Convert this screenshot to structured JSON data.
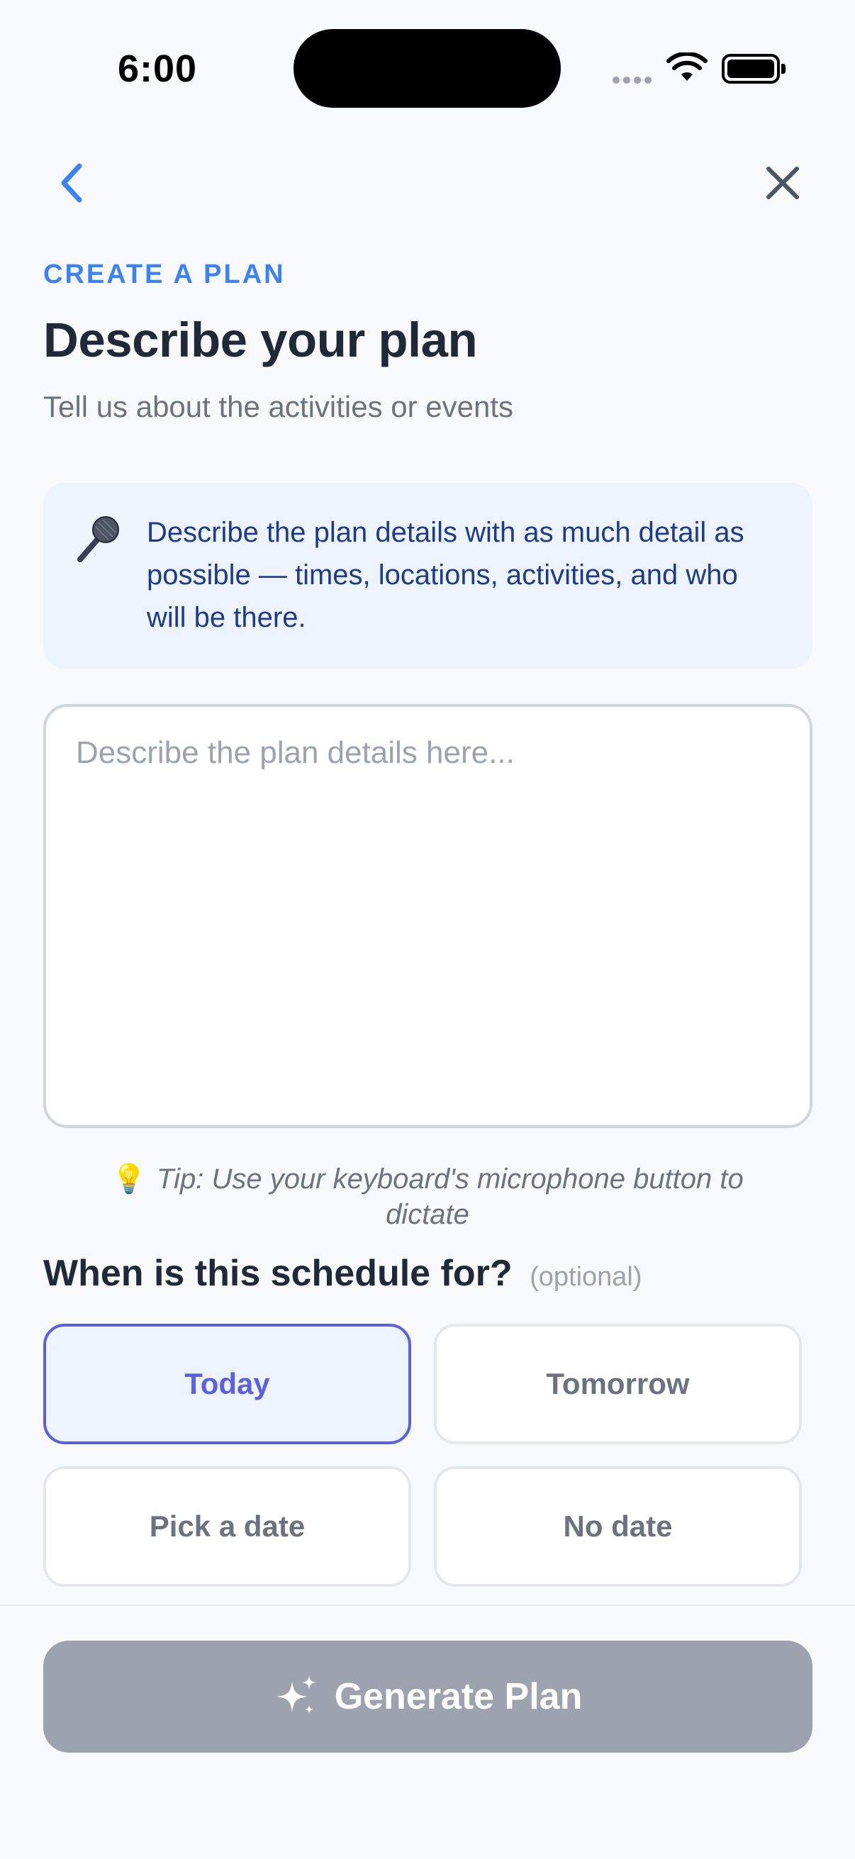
{
  "status_bar": {
    "time": "6:00"
  },
  "nav": {
    "back_icon": "chevron-left-icon",
    "close_icon": "close-icon",
    "accent_color": "#3b82f6"
  },
  "header": {
    "eyebrow": "CREATE A PLAN",
    "title": "Describe your plan",
    "subtitle": "Tell us about the activities or events"
  },
  "info_card": {
    "icon": "microphone-icon",
    "text": "Describe the plan details with as much detail as possible — times, locations, activities, and who will be there."
  },
  "plan_input": {
    "value": "",
    "placeholder": "Describe the plan details here..."
  },
  "tip": {
    "icon": "lightbulb-icon",
    "text": "Tip: Use your keyboard's microphone button to dictate"
  },
  "schedule": {
    "heading": "When is this schedule for?",
    "optional_label": "(optional)",
    "options": [
      {
        "label": "Today",
        "selected": true
      },
      {
        "label": "Tomorrow",
        "selected": false
      },
      {
        "label": "Pick a date",
        "selected": false
      },
      {
        "label": "No date",
        "selected": false
      }
    ],
    "selected_color": "#5b5fe0"
  },
  "footer": {
    "generate_label": "Generate Plan",
    "generate_icon": "sparkle-icon",
    "button_color": "#9ca3af"
  }
}
